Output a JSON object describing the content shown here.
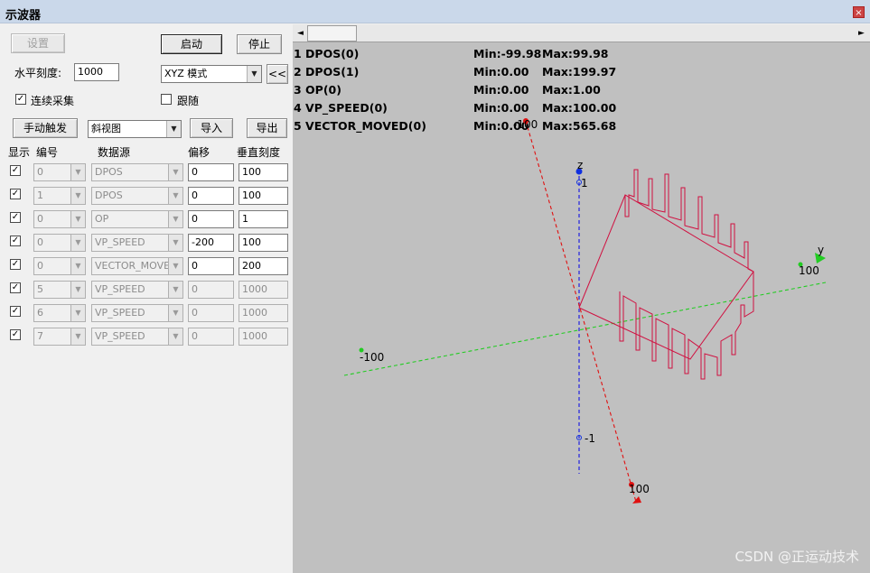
{
  "window": {
    "title": "示波器",
    "close_glyph": "×"
  },
  "toolbar": {
    "settings_label": "设置",
    "start_label": "启动",
    "stop_label": "停止",
    "hscale_label": "水平刻度:",
    "hscale_value": "1000",
    "mode_value": "XYZ 模式",
    "collapse_label": "<<",
    "continuous_label": "连续采集",
    "continuous_checked": true,
    "follow_label": "跟随",
    "follow_checked": false,
    "manual_trigger_label": "手动触发",
    "view_value": "斜视图",
    "import_label": "导入",
    "export_label": "导出"
  },
  "table": {
    "headers": [
      "显示",
      "编号",
      "数据源",
      "偏移",
      "垂直刻度"
    ],
    "rows": [
      {
        "show": true,
        "id": "0",
        "source": "DPOS",
        "offset": "0",
        "scale": "100",
        "enabled": true
      },
      {
        "show": true,
        "id": "1",
        "source": "DPOS",
        "offset": "0",
        "scale": "100",
        "enabled": true
      },
      {
        "show": true,
        "id": "0",
        "source": "OP",
        "offset": "0",
        "scale": "1",
        "enabled": true
      },
      {
        "show": true,
        "id": "0",
        "source": "VP_SPEED",
        "offset": "-200",
        "scale": "100",
        "enabled": true
      },
      {
        "show": true,
        "id": "0",
        "source": "VECTOR_MOVED",
        "offset": "0",
        "scale": "200",
        "enabled": true
      },
      {
        "show": true,
        "id": "5",
        "source": "VP_SPEED",
        "offset": "0",
        "scale": "1000",
        "enabled": false
      },
      {
        "show": true,
        "id": "6",
        "source": "VP_SPEED",
        "offset": "0",
        "scale": "1000",
        "enabled": false
      },
      {
        "show": true,
        "id": "7",
        "source": "VP_SPEED",
        "offset": "0",
        "scale": "1000",
        "enabled": false
      }
    ]
  },
  "legend": [
    {
      "name": "1 DPOS(0)",
      "min": "Min:-99.98",
      "max": "Max:99.98"
    },
    {
      "name": "2 DPOS(1)",
      "min": "Min:0.00",
      "max": "Max:199.97"
    },
    {
      "name": "3 OP(0)",
      "min": "Min:0.00",
      "max": "Max:1.00"
    },
    {
      "name": "4 VP_SPEED(0)",
      "min": "Min:0.00",
      "max": "Max:100.00"
    },
    {
      "name": "5 VECTOR_MOVED(0)",
      "min": "Min:0.00",
      "max": "Max:565.68"
    }
  ],
  "plot": {
    "axis_labels": {
      "x_neg": "-100",
      "x_pos": "100",
      "y_neg": "-100",
      "y_pos": "100",
      "y_name": "y",
      "z_name": "z",
      "z_pos": "1",
      "z_neg": "-1"
    },
    "colors": {
      "x_axis": "#e01010",
      "y_axis": "#22cc22",
      "z_axis": "#1030e0",
      "trace": "#d01040",
      "background": "#c0c0c0"
    }
  },
  "scrollbar": {
    "left_glyph": "◄",
    "right_glyph": "►"
  },
  "watermark": "CSDN @正运动技术"
}
